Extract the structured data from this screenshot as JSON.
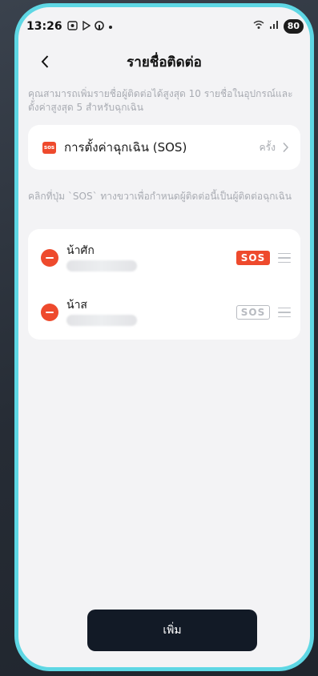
{
  "status_bar": {
    "time": "13:26",
    "battery": "80"
  },
  "header": {
    "title": "รายชื่อติดต่อ"
  },
  "info_text": "คุณสามารถเพิ่มรายชื่อผู้ติดต่อได้สูงสุด 10 รายชื่อในอุปกรณ์และตั้งค่าสูงสุด 5 สำหรับฉุกเฉิน",
  "sos_settings": {
    "chip": "sos",
    "label": "การตั้งค่าฉุกเฉิน (SOS)",
    "value": "ครั้ง"
  },
  "hint_text": "คลิกที่ปุ่ม `SOS` ทางขวาเพื่อกำหนดผู้ติดต่อนี้เป็นผู้ติดต่อฉุกเฉิน",
  "contacts": [
    {
      "name": "น้าศัก",
      "sos_label": "SOS",
      "sos_active": true
    },
    {
      "name": "น้าส",
      "sos_label": "SOS",
      "sos_active": false
    }
  ],
  "add_button": {
    "label": "เพิ่ม"
  },
  "colors": {
    "accent": "#ee4a2d",
    "frame": "#5ed7e4",
    "button": "#121a26"
  }
}
